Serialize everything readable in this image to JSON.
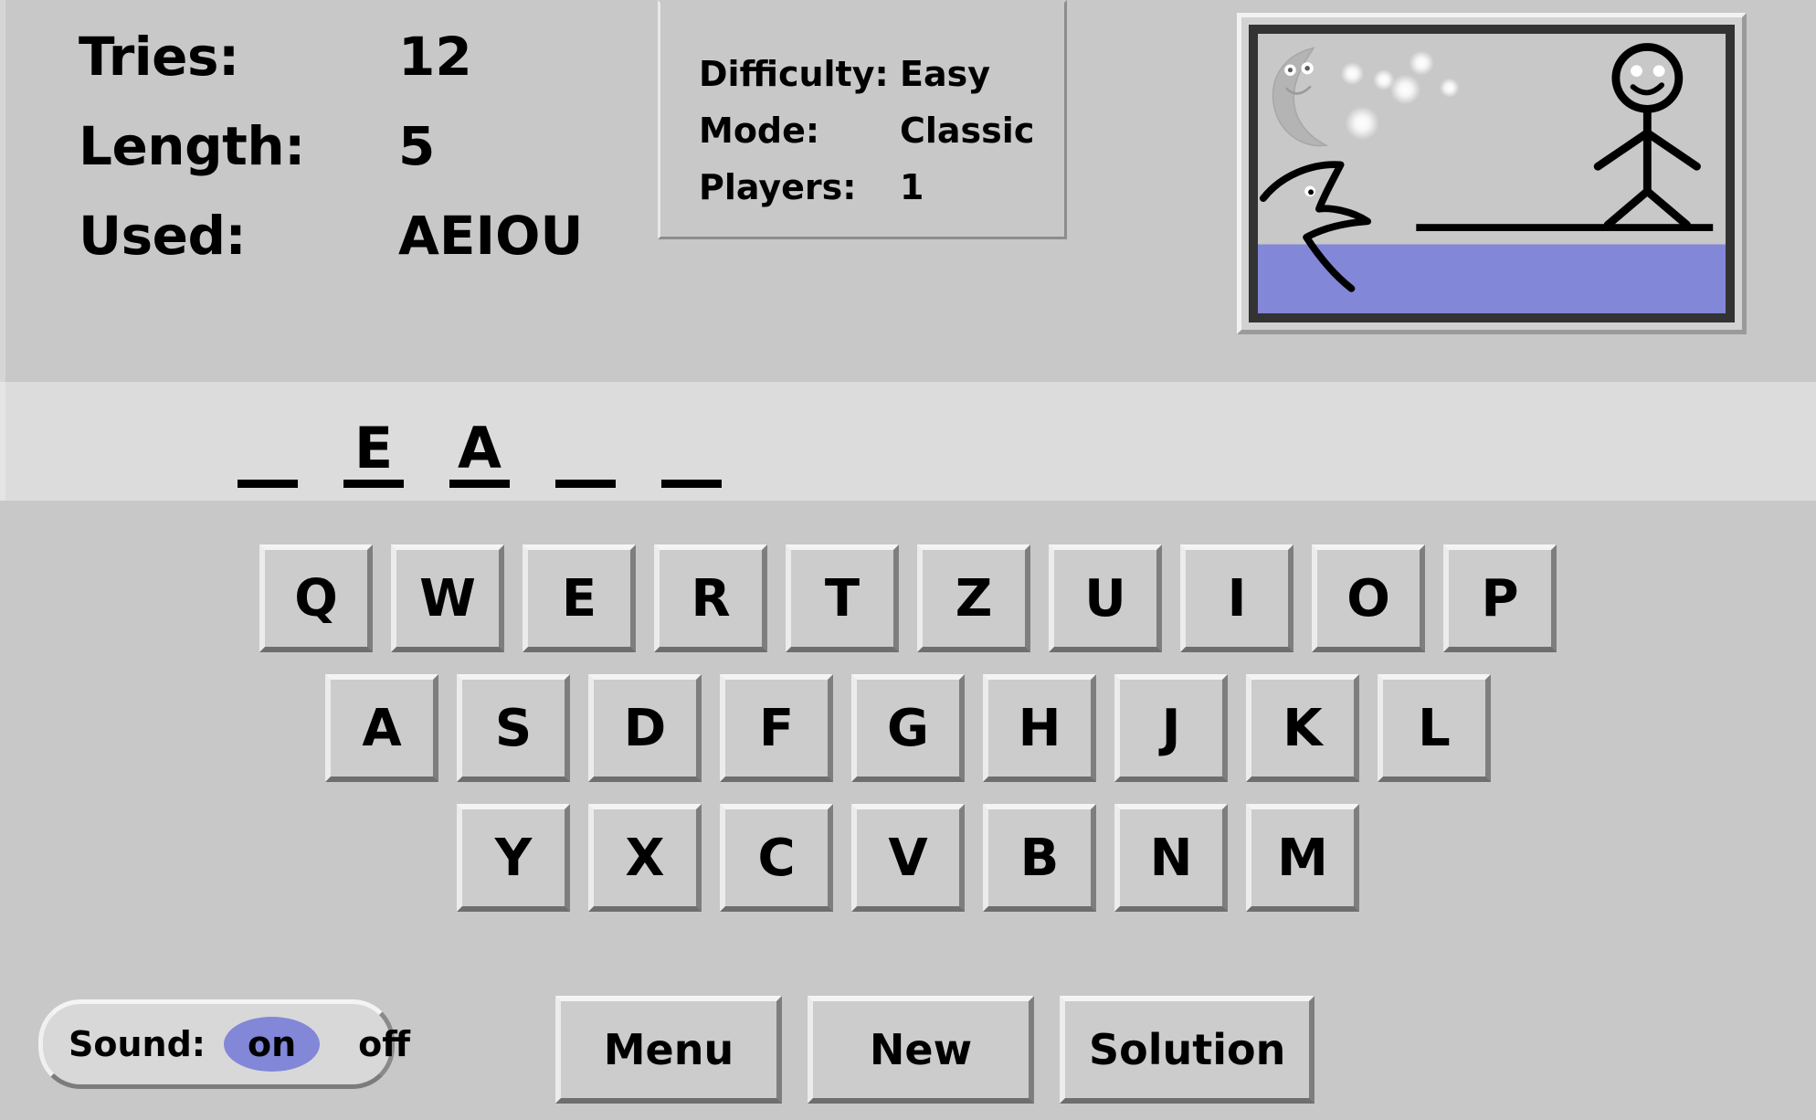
{
  "stats": {
    "rows": [
      {
        "label": "Tries:",
        "value": "12"
      },
      {
        "label": "Length:",
        "value": "5"
      },
      {
        "label": "Used:",
        "value": "AEIOU"
      }
    ]
  },
  "settings": {
    "rows": [
      {
        "label": "Difficulty:",
        "value": "Easy"
      },
      {
        "label": "Mode:",
        "value": "Classic"
      },
      {
        "label": "Players:",
        "value": "1"
      }
    ]
  },
  "scene": {
    "description": "hangman-scene-stick-figure-on-plank-over-water",
    "water_color": "#8287d8",
    "sky_color": "#c8c8c8",
    "moon_color": "#b4b4b4",
    "ink_color": "#000000",
    "border_color": "#333333",
    "stage": "plank-intact",
    "elements": [
      "moon-icon",
      "stars-icon",
      "shark-icon",
      "water",
      "plank",
      "stick-figure-icon"
    ]
  },
  "word": {
    "slots": [
      {
        "letter": "",
        "revealed": false
      },
      {
        "letter": "E",
        "revealed": true
      },
      {
        "letter": "A",
        "revealed": true
      },
      {
        "letter": "",
        "revealed": false
      },
      {
        "letter": "",
        "revealed": false
      }
    ],
    "length": 5
  },
  "keyboard": {
    "layout": "QWERTZ",
    "rows": [
      [
        "Q",
        "W",
        "E",
        "R",
        "T",
        "Z",
        "U",
        "I",
        "O",
        "P"
      ],
      [
        "A",
        "S",
        "D",
        "F",
        "G",
        "H",
        "J",
        "K",
        "L"
      ],
      [
        "Y",
        "X",
        "C",
        "V",
        "B",
        "N",
        "M"
      ]
    ]
  },
  "sound": {
    "label": "Sound:",
    "on_label": "on",
    "off_label": "off",
    "state": "on",
    "highlight_color": "#8287d8"
  },
  "actions": {
    "buttons": [
      {
        "label": "Menu"
      },
      {
        "label": "New"
      },
      {
        "label": "Solution"
      }
    ]
  }
}
